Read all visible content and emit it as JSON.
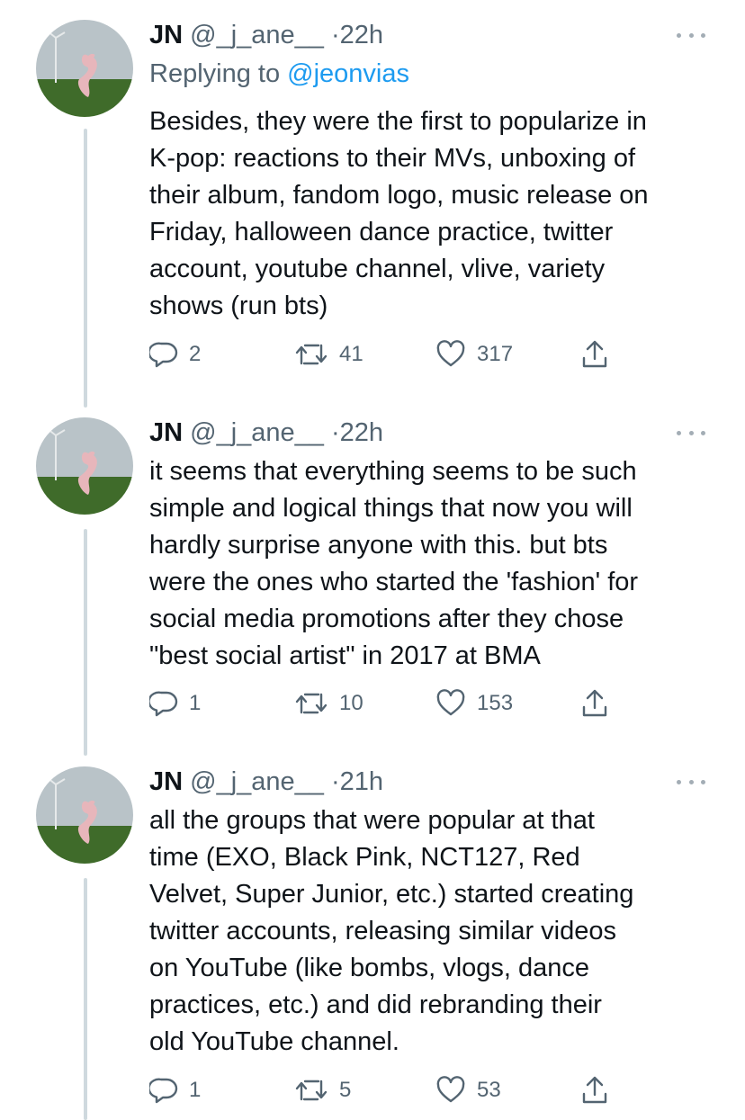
{
  "colors": {
    "text": "#0f1419",
    "secondary": "#536471",
    "link": "#1d9bf0",
    "thread_line": "#cfd9de"
  },
  "tweets": [
    {
      "name": "JN",
      "handle": "@_j_ane__",
      "sep": "·",
      "time": "22h",
      "replying_label": "Replying to",
      "replying_handle": "@jeonvias",
      "text": "Besides, they were the first to popularize in\nK-pop: reactions to their MVs, unboxing of\ntheir album, fandom logo, music release on\nFriday, halloween dance practice, twitter\naccount, youtube channel, vlive, variety\nshows (run bts)",
      "replies": "2",
      "retweets": "41",
      "likes": "317"
    },
    {
      "name": "JN",
      "handle": "@_j_ane__",
      "sep": "·",
      "time": "22h",
      "text": "it seems that everything seems to be such\nsimple and logical things that now you will\nhardly surprise anyone with this.  but bts\nwere the ones who started the 'fashion' for\nsocial media promotions after they chose\n\"best social artist\" in 2017 at BMA",
      "replies": "1",
      "retweets": "10",
      "likes": "153"
    },
    {
      "name": "JN",
      "handle": "@_j_ane__",
      "sep": "·",
      "time": "21h",
      "text": "all the groups that were popular at that\ntime (EXO, Black Pink, NCT127, Red\nVelvet, Super Junior, etc.) started creating\ntwitter accounts, releasing similar videos\non YouTube (like bombs, vlogs, dance\npractices, etc.) and did rebranding  their\nold YouTube channel.",
      "replies": "1",
      "retweets": "5",
      "likes": "53"
    }
  ],
  "icons": {
    "reply": "speech-bubble-icon",
    "retweet": "retweet-arrows-icon",
    "like": "heart-icon",
    "share": "share-upload-icon",
    "more": "three-dots-icon",
    "avatar": "pink-figure-in-field-avatar"
  }
}
